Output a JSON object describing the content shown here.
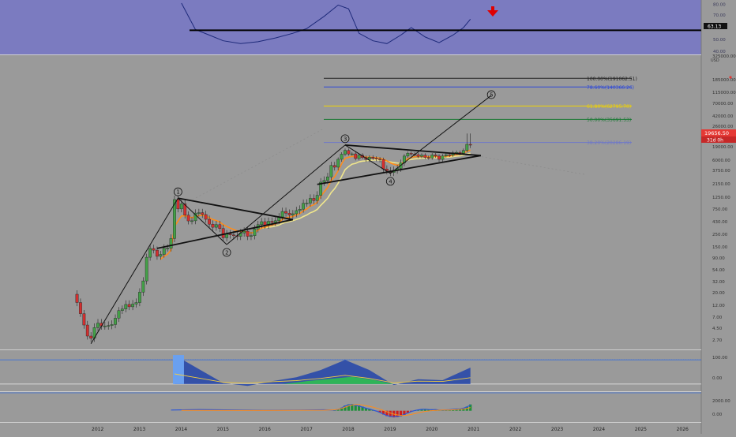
{
  "colors": {
    "background": "#9a9a9a",
    "rsi_panel": "#7b7bc0",
    "bull_candle": "#43a047",
    "bear_candle": "#d32f2f",
    "ema_orange": "#ff8c1a",
    "ema_yellow": "#f0e68c",
    "trendline": "#111111",
    "price_label": "#e53935",
    "red_arrow": "#e00000"
  },
  "icons": {
    "signal_arrow": "red-down-arrow-icon"
  },
  "chart_data": [
    {
      "type": "line",
      "panel": "rsi",
      "yticks": [
        "80.00",
        "70.00",
        "60.00",
        "50.00",
        "40.00"
      ],
      "ylim": [
        40,
        92
      ],
      "level": 63.13,
      "level_label": "63.13",
      "x": [
        "2014-01",
        "2014-05",
        "2014-09",
        "2015-01",
        "2015-06",
        "2015-11",
        "2016-04",
        "2016-09",
        "2017-01",
        "2017-06",
        "2017-10",
        "2018-01",
        "2018-04",
        "2018-08",
        "2018-12",
        "2019-04",
        "2019-07",
        "2019-11",
        "2020-03",
        "2020-07",
        "2020-10",
        "2020-12"
      ],
      "values": [
        92,
        64,
        58,
        52,
        49,
        51,
        55,
        60,
        65,
        78,
        90,
        86,
        60,
        52,
        49,
        58,
        66,
        56,
        50,
        58,
        66,
        75
      ]
    },
    {
      "type": "candlestick",
      "panel": "price",
      "scale": "log",
      "price_label": "19656.50",
      "time_label": "31d 0h",
      "yticks": [
        "325000.00",
        "185000.00",
        "115000.00",
        "70000.00",
        "42000.00",
        "26000.00",
        "19000.00",
        "6000.00",
        "3750.00",
        "2150.00",
        "1250.00",
        "750.00",
        "430.00",
        "250.00",
        "150.00",
        "90.00",
        "54.00",
        "32.00",
        "20.00",
        "12.00",
        "7.00",
        "4.50",
        "2.70"
      ],
      "xticks": [
        "2012",
        "2013",
        "2014",
        "2015",
        "2016",
        "2017",
        "2018",
        "2019",
        "2020",
        "2021",
        "2022",
        "2023",
        "2024",
        "2025",
        "2026"
      ],
      "x": [
        "2011-07",
        "2011-08",
        "2011-09",
        "2011-10",
        "2011-11",
        "2011-12",
        "2012-01",
        "2012-02",
        "2012-03",
        "2012-04",
        "2012-05",
        "2012-06",
        "2012-07",
        "2012-08",
        "2012-09",
        "2012-10",
        "2012-11",
        "2012-12",
        "2013-01",
        "2013-02",
        "2013-03",
        "2013-04",
        "2013-05",
        "2013-06",
        "2013-07",
        "2013-08",
        "2013-09",
        "2013-10",
        "2013-11",
        "2013-12",
        "2014-01",
        "2014-02",
        "2014-03",
        "2014-04",
        "2014-05",
        "2014-06",
        "2014-07",
        "2014-08",
        "2014-09",
        "2014-10",
        "2014-11",
        "2014-12",
        "2015-01",
        "2015-02",
        "2015-03",
        "2015-04",
        "2015-05",
        "2015-06",
        "2015-07",
        "2015-08",
        "2015-09",
        "2015-10",
        "2015-11",
        "2015-12",
        "2016-01",
        "2016-02",
        "2016-03",
        "2016-04",
        "2016-05",
        "2016-06",
        "2016-07",
        "2016-08",
        "2016-09",
        "2016-10",
        "2016-11",
        "2016-12",
        "2017-01",
        "2017-02",
        "2017-03",
        "2017-04",
        "2017-05",
        "2017-06",
        "2017-07",
        "2017-08",
        "2017-09",
        "2017-10",
        "2017-11",
        "2017-12",
        "2018-01",
        "2018-02",
        "2018-03",
        "2018-04",
        "2018-05",
        "2018-06",
        "2018-07",
        "2018-08",
        "2018-09",
        "2018-10",
        "2018-11",
        "2018-12",
        "2019-01",
        "2019-02",
        "2019-03",
        "2019-04",
        "2019-05",
        "2019-06",
        "2019-07",
        "2019-08",
        "2019-09",
        "2019-10",
        "2019-11",
        "2019-12",
        "2020-01",
        "2020-02",
        "2020-03",
        "2020-04",
        "2020-05",
        "2020-06",
        "2020-07",
        "2020-08",
        "2020-09",
        "2020-10",
        "2020-11",
        "2020-12"
      ],
      "close": [
        13.4,
        8.2,
        5.1,
        3.2,
        2.9,
        4.6,
        5.5,
        4.9,
        4.9,
        5.0,
        5.2,
        6.7,
        9.4,
        10.1,
        12.4,
        11.2,
        12.6,
        13.4,
        20.4,
        33,
        93,
        139,
        129,
        97,
        106,
        141,
        141,
        211,
        1129,
        754,
        938,
        573,
        444,
        447,
        628,
        640,
        589,
        477,
        386,
        338,
        378,
        320,
        217,
        254,
        244,
        236,
        230,
        264,
        285,
        230,
        236,
        314,
        378,
        430,
        369,
        437,
        416,
        448,
        530,
        674,
        624,
        575,
        609,
        700,
        744,
        960,
        970,
        1190,
        1080,
        1350,
        2300,
        2480,
        2870,
        4700,
        4340,
        6450,
        10000,
        13800,
        10200,
        10300,
        6900,
        9200,
        7500,
        6400,
        7700,
        7000,
        6600,
        6300,
        4000,
        3700,
        3450,
        3800,
        4100,
        5300,
        8500,
        10800,
        10100,
        9600,
        8300,
        9200,
        7550,
        7200,
        9350,
        8500,
        6400,
        8600,
        9450,
        9150,
        11350,
        11650,
        10780,
        13800,
        19700,
        19656.5
      ]
    },
    {
      "type": "area",
      "panel": "oscillator",
      "yticks": [
        "100.00",
        "0.00"
      ],
      "ylim": [
        -20,
        130
      ],
      "x": [
        "2013-11",
        "2014-06",
        "2015-01",
        "2015-08",
        "2016-03",
        "2016-10",
        "2017-05",
        "2017-12",
        "2018-07",
        "2019-02",
        "2019-09",
        "2020-04",
        "2020-12"
      ],
      "values": [
        120,
        62,
        4,
        -8,
        12,
        28,
        58,
        100,
        58,
        -4,
        20,
        16,
        68
      ]
    },
    {
      "type": "bar",
      "panel": "macd",
      "yticks": [
        "2000.00",
        "0.00"
      ],
      "ylim": [
        -1800,
        2800
      ],
      "x": [
        "2017-09",
        "2017-10",
        "2017-11",
        "2017-12",
        "2018-01",
        "2018-02",
        "2018-03",
        "2018-04",
        "2018-05",
        "2018-06",
        "2018-07",
        "2018-08",
        "2018-09",
        "2018-10",
        "2018-11",
        "2018-12",
        "2019-01",
        "2019-02",
        "2019-03",
        "2019-04",
        "2019-05",
        "2019-06",
        "2019-07",
        "2019-08",
        "2019-09",
        "2019-10",
        "2019-11",
        "2019-12",
        "2020-01",
        "2020-02",
        "2020-03",
        "2020-04",
        "2020-05",
        "2020-06",
        "2020-07",
        "2020-08",
        "2020-09",
        "2020-10",
        "2020-11",
        "2020-12"
      ],
      "values": [
        120,
        260,
        520,
        900,
        1100,
        1150,
        1000,
        900,
        700,
        480,
        320,
        120,
        -80,
        -320,
        -650,
        -920,
        -1080,
        -1150,
        -1100,
        -960,
        -720,
        -420,
        -150,
        40,
        160,
        250,
        280,
        220,
        190,
        230,
        140,
        120,
        160,
        190,
        260,
        330,
        360,
        480,
        720,
        1080
      ],
      "signal": [
        160,
        240,
        400,
        620,
        820,
        980,
        1050,
        1040,
        980,
        880,
        760,
        620,
        460,
        270,
        60,
        -180,
        -400,
        -580,
        -720,
        -800,
        -820,
        -760,
        -640,
        -500,
        -360,
        -230,
        -120,
        -40,
        20,
        70,
        100,
        115,
        125,
        140,
        165,
        200,
        240,
        300,
        400,
        560
      ]
    }
  ],
  "annotations": {
    "wave_labels": [
      "1",
      "2",
      "3",
      "4",
      "5"
    ],
    "fib_levels": [
      {
        "label": "100.00%(191062.51)",
        "price": 191062.51,
        "color": "#222222"
      },
      {
        "label": "78.60%(140366.26)",
        "price": 140366.26,
        "color": "#2e49d8"
      },
      {
        "label": "61.80%(62795.70)",
        "price": 62795.7,
        "color": "#f1d400"
      },
      {
        "label": "50.00%(35691.53)",
        "price": 35691.53,
        "color": "#1c7a36"
      },
      {
        "label": "38.20%(20286.19)",
        "price": 20286.19,
        "color": "#6f78c8"
      }
    ]
  }
}
